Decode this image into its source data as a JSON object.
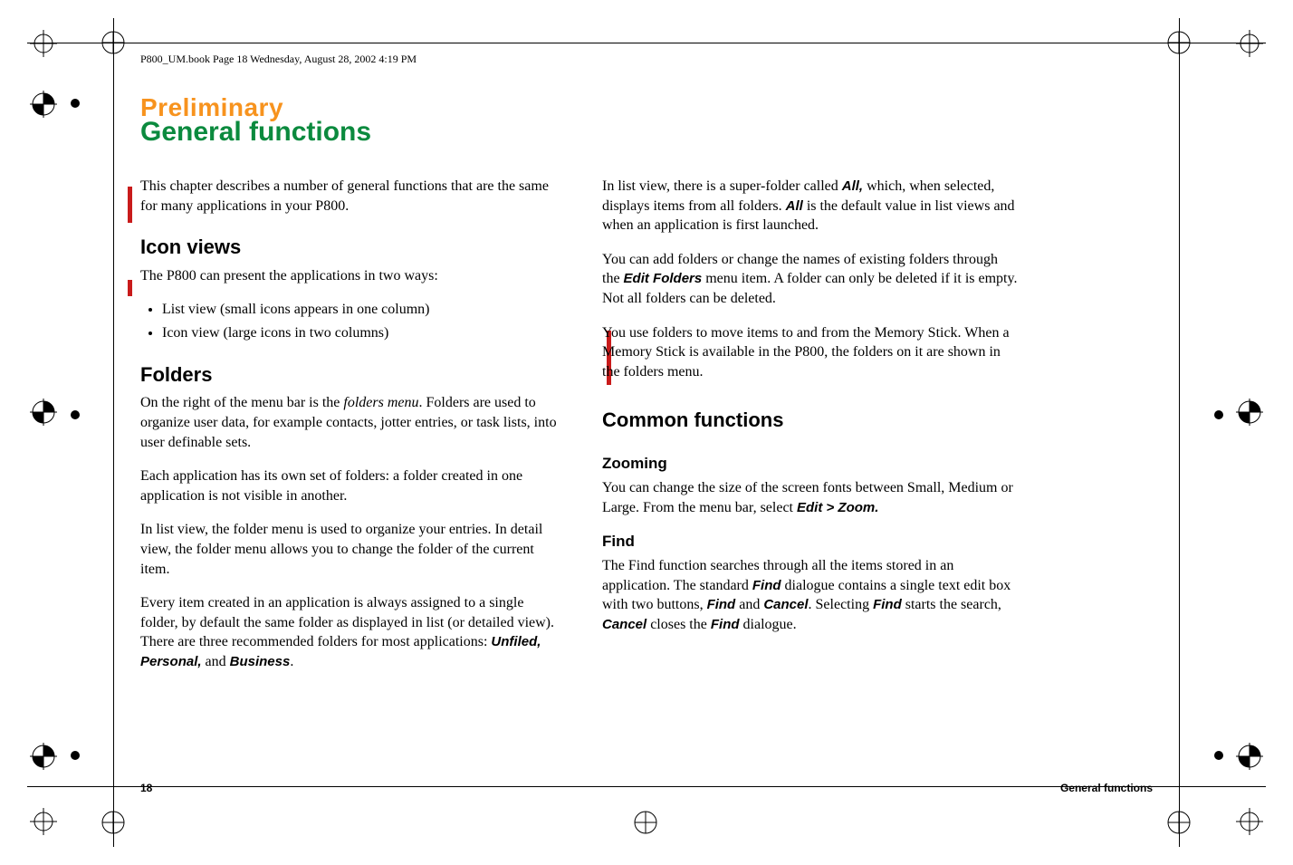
{
  "header": {
    "running_head": "P800_UM.book  Page 18  Wednesday, August 28, 2002  4:19 PM"
  },
  "watermark": "Preliminary",
  "chapter_title": "General functions",
  "left": {
    "intro": "This chapter describes a number of general functions that are the same for many applications in your P800.",
    "icon_views_heading": "Icon views",
    "icon_views_p1": "The P800 can present the applications in two ways:",
    "bullets": {
      "0": "List view (small icons appears in one column)",
      "1": "Icon view (large icons in two columns)"
    },
    "folders_heading": "Folders",
    "folders_p1_a": "On the right of the menu bar is the ",
    "folders_p1_b": "folders menu",
    "folders_p1_c": ". Folders are used to organize user data, for example contacts, jotter entries, or task lists, into user definable sets.",
    "folders_p2": "Each application has its own set of folders: a folder created in one application is not visible in another.",
    "folders_p3": "In list view, the folder menu is used to organize your entries. In detail view, the folder menu allows you to change the folder of the current item.",
    "folders_p4_a": "Every item created in an application is always assigned to a single folder, by default the same folder as displayed in list (or detailed view). There are three recommended folders for most applications: ",
    "folders_p4_b": "Unfiled, Personal,",
    "folders_p4_c": " and ",
    "folders_p4_d": "Business",
    "folders_p4_e": "."
  },
  "right": {
    "p1_a": "In list view, there is a super-folder called ",
    "p1_b": "All,",
    "p1_c": " which, when selected, displays items from all folders. ",
    "p1_d": "All",
    "p1_e": " is the default value in list views and when an application is first launched.",
    "p2_a": "You can add folders or change the names of existing folders through the ",
    "p2_b": "Edit Folders",
    "p2_c": " menu item. A folder can only be deleted if it is empty. Not all folders can be deleted.",
    "p3": "You use folders to move items to and from the Memory Stick. When a Memory Stick is available in the P800, the folders on it are shown in the folders menu.",
    "common_heading": "Common functions",
    "zoom_heading": "Zooming",
    "zoom_p_a": "You can change the size of the screen fonts between Small, Medium or Large. From the menu bar, select ",
    "zoom_p_b": "Edit > Zoom.",
    "find_heading": "Find",
    "find_p_a": "The Find function searches through all the items stored in an application. The standard ",
    "find_p_b": "Find",
    "find_p_c": " dialogue contains a single text edit box with two buttons, ",
    "find_p_d": "Find",
    "find_p_e": " and ",
    "find_p_f": "Cancel",
    "find_p_g": ". Selecting ",
    "find_p_h": "Find",
    "find_p_i": " starts the search, ",
    "find_p_j": "Cancel",
    "find_p_k": " closes the ",
    "find_p_l": "Find",
    "find_p_m": " dialogue."
  },
  "footer": {
    "page": "18",
    "section": "General functions"
  }
}
